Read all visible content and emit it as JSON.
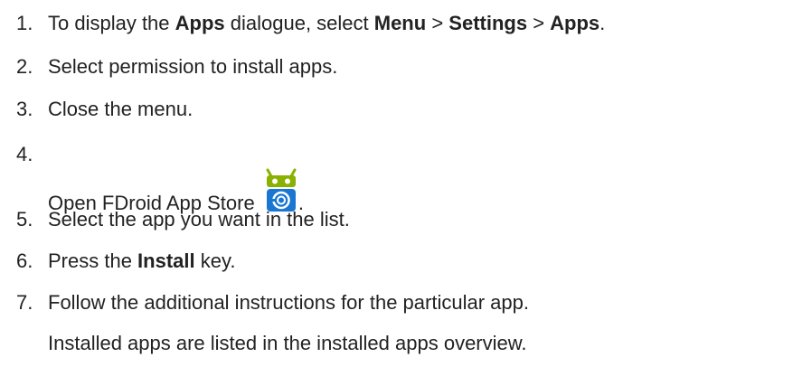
{
  "steps": [
    {
      "number": "1.",
      "parts": {
        "a": "To display the ",
        "b": "Apps",
        "c": " dialogue, select ",
        "d": "Menu",
        "e": " > ",
        "f": "Settings",
        "g": " > ",
        "h": "Apps",
        "i": "."
      }
    },
    {
      "number": "2.",
      "text": "Select permission to install apps."
    },
    {
      "number": "3.",
      "text": "Close the menu."
    },
    {
      "number": "4.",
      "text": "Open FDroid App Store",
      "suffix": ".",
      "icon": "fdroid-app-store-icon"
    },
    {
      "number": "5.",
      "text": "Select the app you want in the list."
    },
    {
      "number": "6.",
      "parts": {
        "a": "Press the ",
        "b": "Install",
        "c": " key."
      }
    },
    {
      "number": "7.",
      "text": "Follow the additional instructions for the particular app."
    }
  ],
  "note": "Installed apps are listed in the installed apps overview.",
  "colors": {
    "text": "#222222",
    "fdroid_head": "#8ab000",
    "fdroid_body": "#1976d2"
  }
}
